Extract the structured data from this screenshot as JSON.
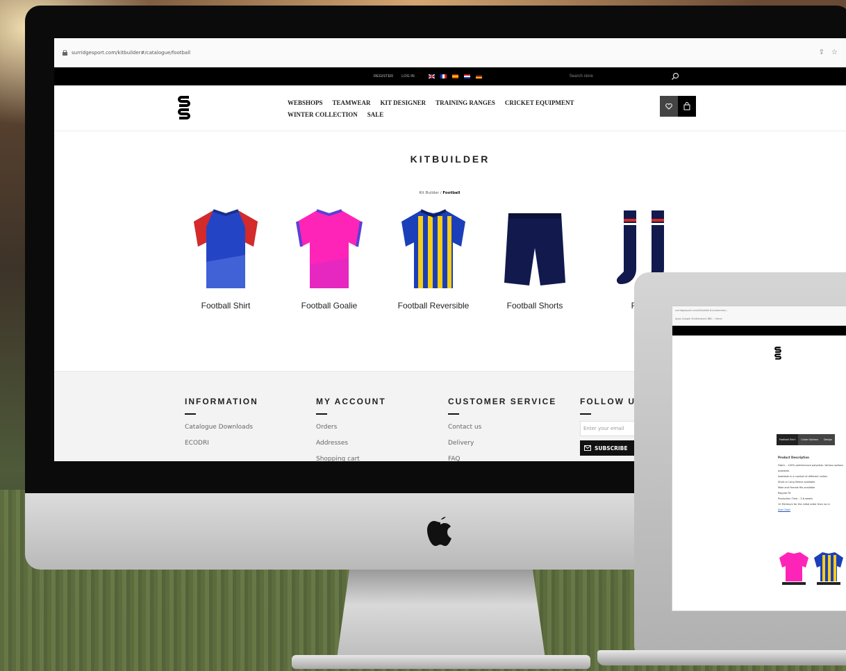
{
  "browser": {
    "url": "surridgesport.com/kitbuilder#/catalogue/football"
  },
  "topbar": {
    "register": "REGISTER",
    "login": "LOG IN",
    "search_placeholder": "Search store"
  },
  "nav": {
    "items": [
      "WEBSHOPS",
      "TEAMWEAR",
      "KIT DESIGNER",
      "TRAINING RANGES",
      "CRICKET EQUIPMENT",
      "WINTER COLLECTION",
      "SALE"
    ]
  },
  "page": {
    "title": "KITBUILDER",
    "breadcrumb_root": "Kit Builder",
    "breadcrumb_sep": " / ",
    "breadcrumb_current": "Football"
  },
  "products": [
    {
      "name": "Football Shirt",
      "colors": [
        "#2444c6",
        "#d42a2a"
      ]
    },
    {
      "name": "Football Goalie",
      "colors": [
        "#ff24b8",
        "#5b3fd6"
      ]
    },
    {
      "name": "Football Reversible",
      "colors": [
        "#f6cc1a",
        "#1b3fb8"
      ]
    },
    {
      "name": "Football Shorts",
      "colors": [
        "#12194d"
      ]
    },
    {
      "name": "Footb",
      "colors": [
        "#12194d",
        "#d42a2a"
      ]
    }
  ],
  "footer": {
    "information": {
      "title": "INFORMATION",
      "items": [
        "Catalogue Downloads",
        "ECODRI"
      ]
    },
    "my_account": {
      "title": "MY ACCOUNT",
      "items": [
        "Orders",
        "Addresses",
        "Shopping cart"
      ]
    },
    "customer_service": {
      "title": "CUSTOMER SERVICE",
      "items": [
        "Contact us",
        "Delivery",
        "FAQ"
      ]
    },
    "follow": {
      "title": "FOLLOW U",
      "email_placeholder": "Enter your email",
      "subscribe": "SUBSCRIBE"
    }
  },
  "laptop": {
    "url": "surridgesport.com/kitbuilder#/customise/...",
    "bookmarks": "Apps  Google  Shutterstock  BBC - Home",
    "tabs": [
      "Football Shirt",
      "Collar Options",
      "Design"
    ],
    "desc_title": "Product Description",
    "desc_lines": [
      "Fabric – 100% performance polyester. Various options available.",
      "Available in a number of different collars",
      "Short or Long Sleeve available",
      "Male and Female fits available",
      "Regular Fit",
      "Production Time – 3-6 weeks",
      "10 Minimum for the initial order then no m"
    ],
    "size_chart": "Size Chart"
  },
  "colors": {
    "accent": "#000000",
    "icon_bg": "#444444"
  }
}
